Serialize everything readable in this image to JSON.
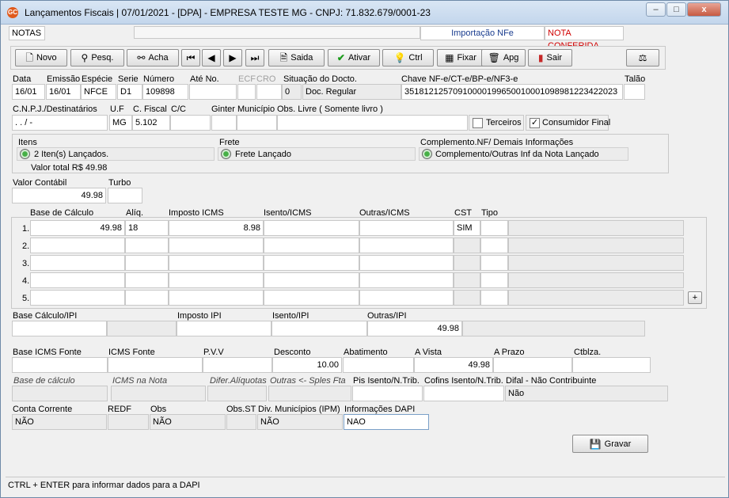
{
  "window": {
    "title": "Lançamentos Fiscais | 07/01/2021 - [DPA] - EMPRESA TESTE MG - CNPJ: 71.832.679/0001-23",
    "minimize": "–",
    "maximize": "□",
    "close": "x",
    "app_icon": "GC"
  },
  "top": {
    "notas_label": "NOTAS",
    "importacao": "Importação NFe",
    "status": "NOTA CONFERIDA",
    "status_color": "#d00000"
  },
  "toolbar": {
    "novo": "Novo",
    "pesq": "Pesq.",
    "acha": "Acha",
    "saida": "Saida",
    "ativar": "Ativar",
    "ctrl": "Ctrl",
    "fixar": "Fixar",
    "apg": "Apg",
    "sair": "Sair"
  },
  "header": {
    "labels": {
      "data": "Data",
      "emissao": "Emissão",
      "especie": "Espécie",
      "serie": "Serie",
      "numero": "Número",
      "ate_no": "Até No.",
      "ecf": "ECF",
      "cro": "CRO",
      "situacao": "Situação do Docto.",
      "chave": "Chave NF-e/CT-e/BP-e/NF3-e",
      "talao": "Talão"
    },
    "data": "16/01",
    "emissao": "16/01",
    "especie": "NFCE",
    "serie": "D1",
    "numero": "109898",
    "ate_no": "",
    "situacao_code": "0",
    "situacao_desc": "Doc. Regular",
    "chave": "35181212570910000199650010001098981223422023",
    "talao": ""
  },
  "dest": {
    "labels": {
      "cnpj": "C.N.P.J./Destinatários",
      "uf": "U.F",
      "cfiscal": "C. Fiscal",
      "cc": "C/C",
      "ginter": "Ginter",
      "municipio": "Município",
      "obs_livre": "Obs. Livre ( Somente livro )"
    },
    "cnpj": " .  .  /  -",
    "uf": "MG",
    "cfiscal": "5.102",
    "cc": "",
    "ginter": "",
    "municipio": "",
    "obs_livre": "",
    "terceiros": "Terceiros",
    "consumidor_final": "Consumidor Final",
    "consumidor_check": "✓"
  },
  "info": {
    "itens_label": "Itens",
    "itens_value": "2 Iten(s) Lançados.",
    "valor_total": "Valor total R$ 49.98",
    "frete_label": "Frete",
    "frete_value": "Frete Lançado",
    "complemento_label": "Complemento.NF/ Demais Informações",
    "complemento_value": "Complemento/Outras Inf da Nota Lançado"
  },
  "valor": {
    "contabil_label": "Valor Contábil",
    "contabil": "49.98",
    "turbo_label": "Turbo",
    "turbo": ""
  },
  "icms": {
    "headers": [
      "Base de Cálculo",
      "Alíq.",
      "Imposto ICMS",
      "Isento/ICMS",
      "Outras/ICMS",
      "CST",
      "Tipo"
    ],
    "rows": [
      {
        "n": "1.",
        "base": "49.98",
        "aliq": "18",
        "imposto": "8.98",
        "isento": "",
        "outras": "",
        "cst": "SIM",
        "tipo": ""
      },
      {
        "n": "2.",
        "base": "",
        "aliq": "",
        "imposto": "",
        "isento": "",
        "outras": "",
        "cst": "",
        "tipo": ""
      },
      {
        "n": "3.",
        "base": "",
        "aliq": "",
        "imposto": "",
        "isento": "",
        "outras": "",
        "cst": "",
        "tipo": ""
      },
      {
        "n": "4.",
        "base": "",
        "aliq": "",
        "imposto": "",
        "isento": "",
        "outras": "",
        "cst": "",
        "tipo": ""
      },
      {
        "n": "5.",
        "base": "",
        "aliq": "",
        "imposto": "",
        "isento": "",
        "outras": "",
        "cst": "",
        "tipo": ""
      }
    ],
    "add": "+"
  },
  "ipi": {
    "base_label": "Base Cálculo/IPI",
    "imposto_label": "Imposto IPI",
    "isento_label": "Isento/IPI",
    "outras_label": "Outras/IPI",
    "outras": "49.98"
  },
  "fonte": {
    "base_label": "Base ICMS Fonte",
    "icms_label": "ICMS Fonte",
    "pvv_label": "P.V.V",
    "desconto_label": "Desconto",
    "abatimento_label": "Abatimento",
    "avista_label": "A Vista",
    "aprazo_label": "A Prazo",
    "ctblza_label": "Ctblza.",
    "desconto": "10.00",
    "avista": "49.98"
  },
  "extra": {
    "base_calc": "Base de cálculo",
    "icms_nota": "ICMS na Nota",
    "difer": "Difer.Alíquotas",
    "outras_sples": "Outras <- Sples Fta",
    "pis_label": "Pis Isento/N.Trib.",
    "cofins_label": "Cofins Isento/N.Trib.",
    "difal_label": "Difal - Não Contribuinte",
    "difal": "Não"
  },
  "bottom": {
    "conta_label": "Conta Corrente",
    "conta": "NÃO",
    "redf_label": "REDF",
    "obs_label": "Obs",
    "obs": "NÃO",
    "obsst_label": "Obs.ST",
    "div_label": "Div. Municípios (IPM)",
    "div": "NÃO",
    "dapi_label": "Informações DAPI",
    "dapi": "NAO",
    "gravar": "Gravar"
  },
  "status_bar": "CTRL + ENTER para informar dados para a DAPI"
}
